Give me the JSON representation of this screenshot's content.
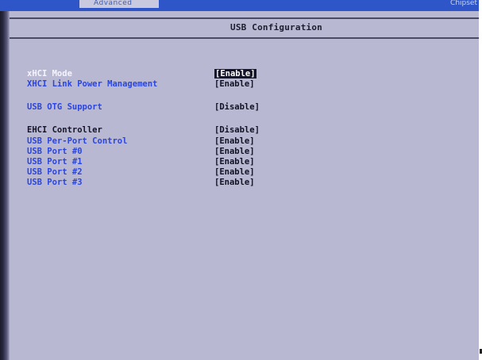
{
  "top_bar": {
    "tab_text": "Advanced",
    "right_text": "Chipset"
  },
  "page": {
    "title": "USB Configuration"
  },
  "settings": [
    {
      "label": "xHCI Mode",
      "value": "[Enable]"
    },
    {
      "label": "XHCI Link Power Management",
      "value": "[Enable]"
    },
    {
      "label": "USB OTG Support",
      "value": "[Disable]"
    },
    {
      "label": "EHCI Controller",
      "value": "[Disable]"
    },
    {
      "label": "USB Per-Port Control",
      "value": "[Enable]"
    },
    {
      "label": "USB Port #0",
      "value": "[Enable]"
    },
    {
      "label": "USB Port #1",
      "value": "[Enable]"
    },
    {
      "label": "USB Port #2",
      "value": "[Enable]"
    },
    {
      "label": "USB Port #3",
      "value": "[Enable]"
    }
  ],
  "colors": {
    "background": "#b9b8d2",
    "option_blue": "#2a45e0",
    "highlight": "#15152a"
  }
}
